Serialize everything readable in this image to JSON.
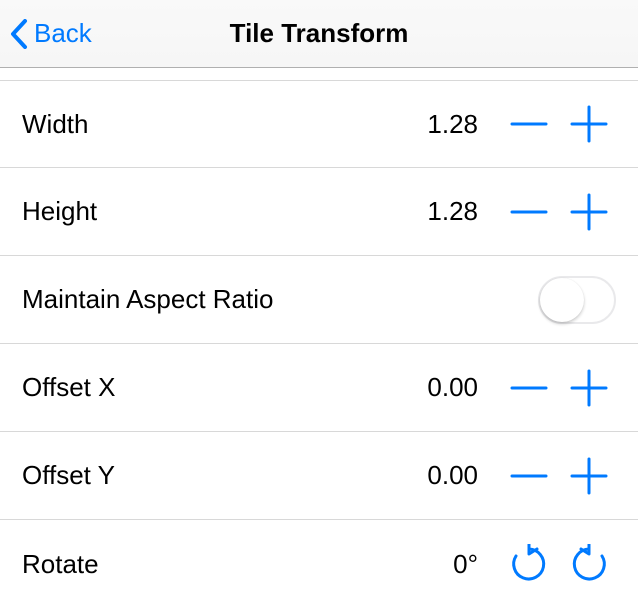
{
  "nav": {
    "back_label": "Back",
    "title": "Tile Transform"
  },
  "rows": {
    "width": {
      "label": "Width",
      "value": "1.28"
    },
    "height": {
      "label": "Height",
      "value": "1.28"
    },
    "aspect": {
      "label": "Maintain Aspect Ratio",
      "on": false
    },
    "offsetx": {
      "label": "Offset X",
      "value": "0.00"
    },
    "offsety": {
      "label": "Offset Y",
      "value": "0.00"
    },
    "rotate": {
      "label": "Rotate",
      "value": "0°"
    }
  },
  "colors": {
    "tint": "#007aff"
  }
}
